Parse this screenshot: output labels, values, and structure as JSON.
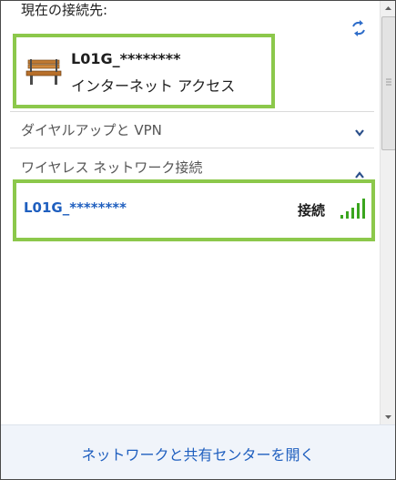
{
  "current_connection": {
    "header": "現在の接続先:",
    "icon": "bench-icon",
    "name": "L01G_********",
    "status": "インターネット アクセス"
  },
  "sections": {
    "dialup": {
      "label": "ダイヤルアップと VPN",
      "state": "collapsed"
    },
    "wireless": {
      "label": "ワイヤレス ネットワーク接続",
      "state": "expanded"
    }
  },
  "networks": [
    {
      "name": "L01G_********",
      "status": "接続",
      "signal_bars": 5
    }
  ],
  "footer": {
    "link_label": "ネットワークと共有センターを開く"
  },
  "colors": {
    "highlight_border": "#8cc84b",
    "link_blue": "#1f5fbf",
    "signal_green": "#3aa51e"
  }
}
